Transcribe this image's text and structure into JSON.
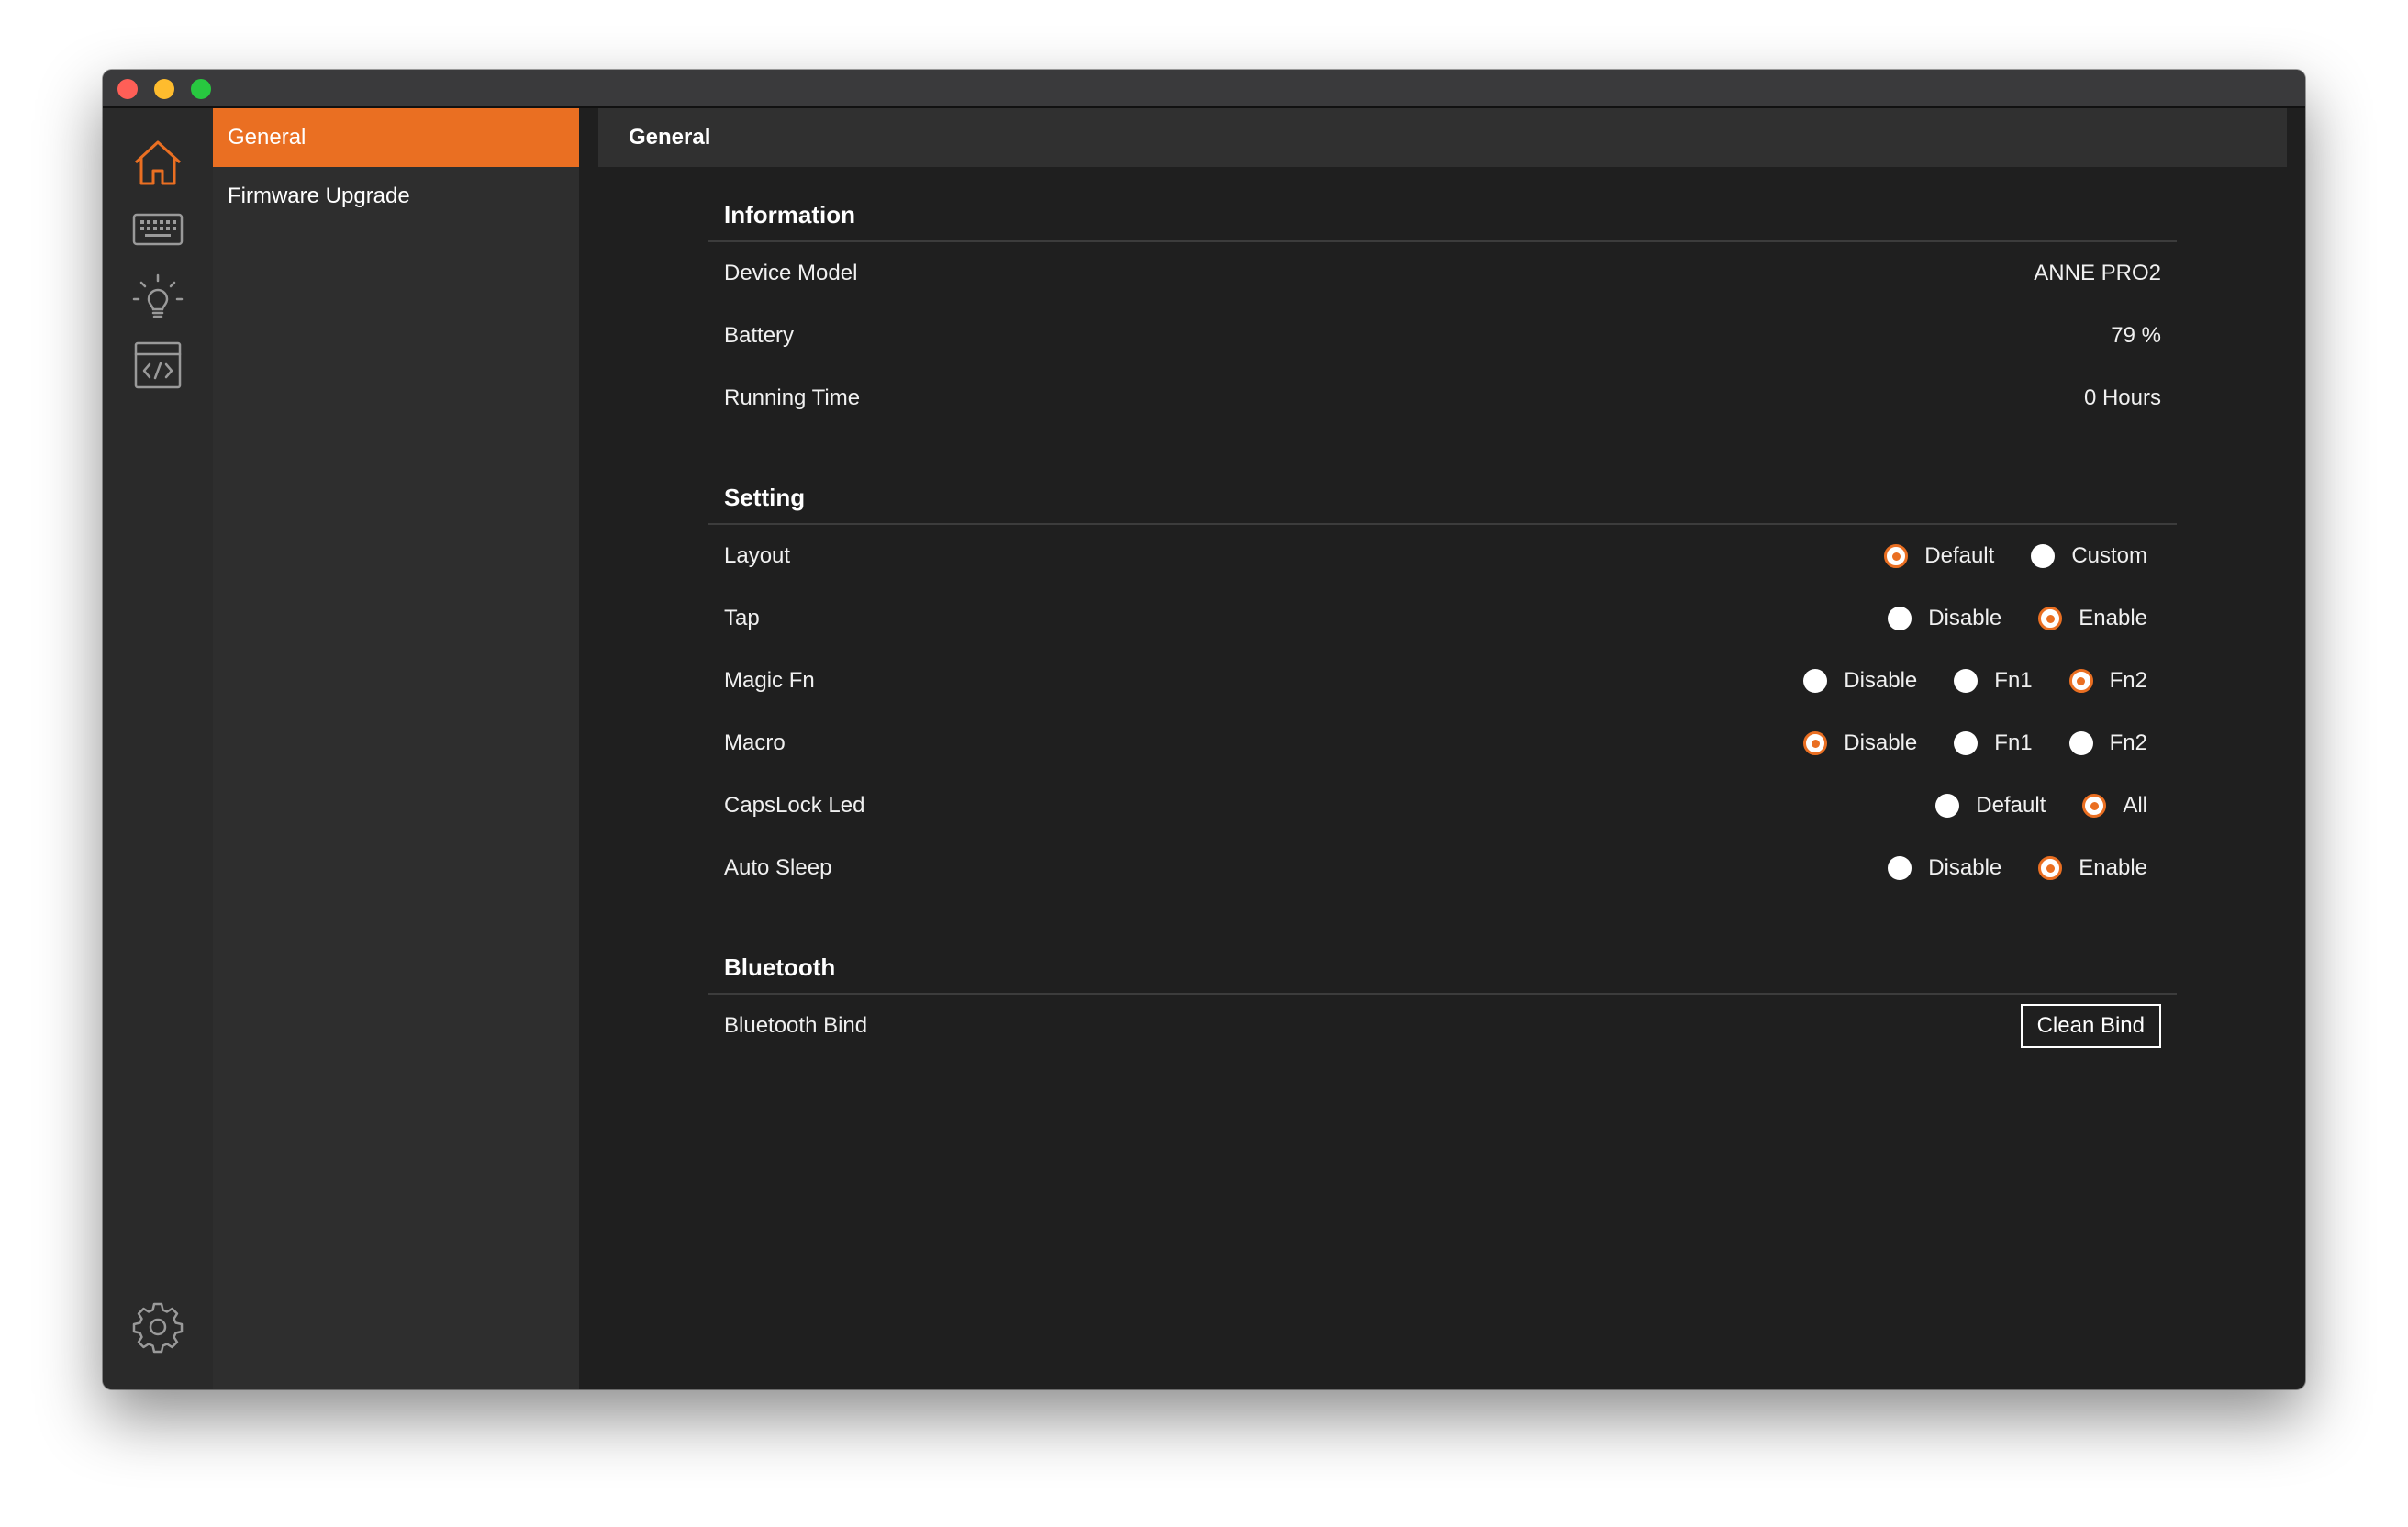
{
  "window": {
    "traffic_lights": [
      "close",
      "minimize",
      "zoom"
    ]
  },
  "iconbar": {
    "items": [
      {
        "icon": "home-icon",
        "active": true
      },
      {
        "icon": "keyboard-icon",
        "active": false
      },
      {
        "icon": "lightbulb-icon",
        "active": false
      },
      {
        "icon": "code-window-icon",
        "active": false
      }
    ],
    "bottom": {
      "icon": "gear-icon"
    }
  },
  "subnav": {
    "items": [
      {
        "label": "General",
        "active": true
      },
      {
        "label": "Firmware Upgrade",
        "active": false
      }
    ]
  },
  "header": {
    "title": "General"
  },
  "information": {
    "title": "Information",
    "rows": [
      {
        "label": "Device Model",
        "value": "ANNE PRO2"
      },
      {
        "label": "Battery",
        "value": "79 %"
      },
      {
        "label": "Running Time",
        "value": "0 Hours"
      }
    ]
  },
  "setting": {
    "title": "Setting",
    "rows": [
      {
        "label": "Layout",
        "options": [
          {
            "label": "Default",
            "checked": true
          },
          {
            "label": "Custom",
            "checked": false
          }
        ]
      },
      {
        "label": "Tap",
        "options": [
          {
            "label": "Disable",
            "checked": false
          },
          {
            "label": "Enable",
            "checked": true
          }
        ]
      },
      {
        "label": "Magic Fn",
        "options": [
          {
            "label": "Disable",
            "checked": false
          },
          {
            "label": "Fn1",
            "checked": false
          },
          {
            "label": "Fn2",
            "checked": true
          }
        ]
      },
      {
        "label": "Macro",
        "options": [
          {
            "label": "Disable",
            "checked": true
          },
          {
            "label": "Fn1",
            "checked": false
          },
          {
            "label": "Fn2",
            "checked": false
          }
        ]
      },
      {
        "label": "CapsLock Led",
        "options": [
          {
            "label": "Default",
            "checked": false
          },
          {
            "label": "All",
            "checked": true
          }
        ]
      },
      {
        "label": "Auto Sleep",
        "options": [
          {
            "label": "Disable",
            "checked": false
          },
          {
            "label": "Enable",
            "checked": true
          }
        ]
      }
    ]
  },
  "bluetooth": {
    "title": "Bluetooth",
    "bind_label": "Bluetooth Bind",
    "button_label": "Clean Bind"
  },
  "colors": {
    "accent": "#ea6f22",
    "background": "#1f1f1f",
    "iconbar": "#2a2a2a",
    "subnav": "#2e2e2e",
    "header": "#303030"
  }
}
